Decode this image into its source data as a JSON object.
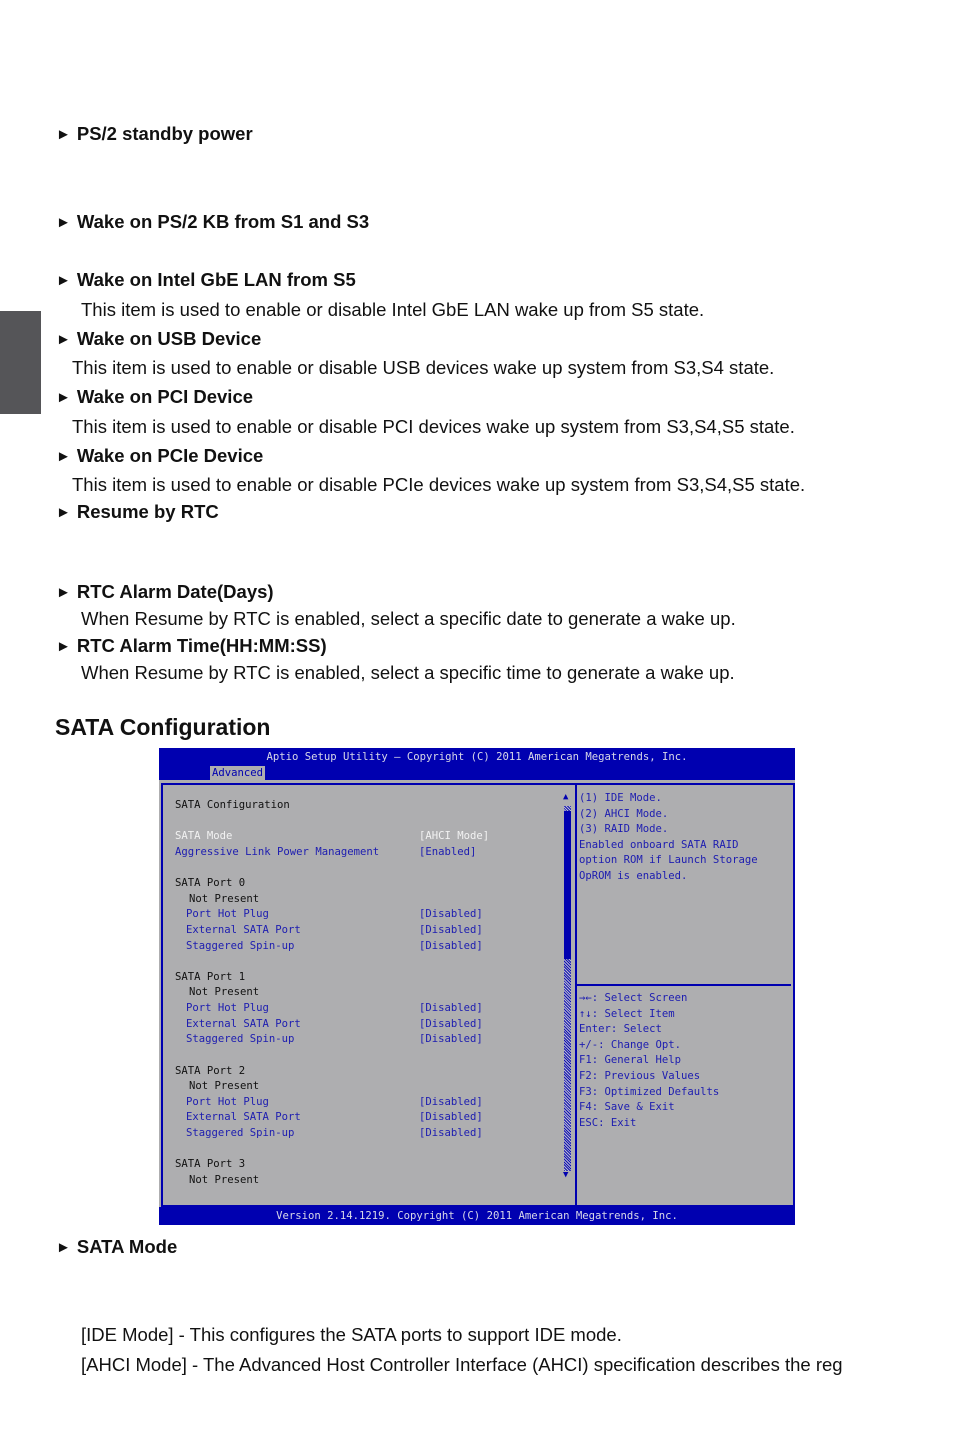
{
  "items": [
    {
      "title": "PS/2 standby power",
      "desc": ""
    },
    {
      "title": "Wake on PS/2 KB from S1 and S3",
      "desc": ""
    },
    {
      "title": "Wake on Intel GbE LAN from S5",
      "desc": "This item is used to enable or disable Intel GbE LAN wake up from S5 state."
    },
    {
      "title": "Wake on USB Device",
      "desc": "This item is used to enable or disable USB devices wake up system  from S3,S4 state."
    },
    {
      "title": "Wake on PCI Device",
      "desc": "This item is used to enable or disable PCI devices wake up system  from S3,S4,S5 state."
    },
    {
      "title": "Wake on PCIe Device",
      "desc": "This item is used to enable or disable PCIe devices wake up system  from S3,S4,S5 state."
    },
    {
      "title": "Resume by RTC",
      "desc": ""
    },
    {
      "title": "RTC Alarm Date(Days)",
      "desc": "When Resume by RTC is enabled, select a specific date to generate a wake up."
    },
    {
      "title": "RTC Alarm Time(HH:MM:SS)",
      "desc": "When Resume by RTC is enabled, select a specific time to generate a wake up."
    }
  ],
  "arrow": "►",
  "section_title": "SATA Configuration",
  "bios": {
    "title": "Aptio Setup Utility – Copyright (C) 2011 American Megatrends, Inc.",
    "tab": "Advanced",
    "footer": "Version 2.14.1219. Copyright (C) 2011 American Megatrends, Inc.",
    "rows": [
      {
        "label": "SATA Configuration",
        "value": "",
        "style": "black"
      },
      {
        "label": "SATA Mode",
        "value": "[AHCI Mode]",
        "style": "white"
      },
      {
        "label": "Aggressive Link Power Management",
        "value": "[Enabled]",
        "style": "blue"
      },
      {
        "label": "SATA Port 0",
        "value": "",
        "style": "black"
      },
      {
        "label": "Not Present",
        "value": "",
        "style": "black"
      },
      {
        "label": "Port Hot Plug",
        "value": "[Disabled]",
        "style": "blue"
      },
      {
        "label": "External SATA Port",
        "value": "[Disabled]",
        "style": "blue"
      },
      {
        "label": "Staggered Spin-up",
        "value": "[Disabled]",
        "style": "blue"
      },
      {
        "label": "SATA Port 1",
        "value": "",
        "style": "black"
      },
      {
        "label": "Not Present",
        "value": "",
        "style": "black"
      },
      {
        "label": "Port Hot Plug",
        "value": "[Disabled]",
        "style": "blue"
      },
      {
        "label": "External SATA Port",
        "value": "[Disabled]",
        "style": "blue"
      },
      {
        "label": "Staggered Spin-up",
        "value": "[Disabled]",
        "style": "blue"
      },
      {
        "label": "SATA Port 2",
        "value": "",
        "style": "black"
      },
      {
        "label": "Not Present",
        "value": "",
        "style": "black"
      },
      {
        "label": "Port Hot Plug",
        "value": "[Disabled]",
        "style": "blue"
      },
      {
        "label": "External SATA Port",
        "value": "[Disabled]",
        "style": "blue"
      },
      {
        "label": "Staggered Spin-up",
        "value": "[Disabled]",
        "style": "blue"
      },
      {
        "label": "SATA Port 3",
        "value": "",
        "style": "black"
      },
      {
        "label": "Not Present",
        "value": "",
        "style": "black"
      }
    ],
    "help": [
      "(1) IDE Mode.",
      "(2) AHCI Mode.",
      "(3) RAID Mode.",
      "Enabled onboard SATA RAID",
      "option ROM if Launch Storage",
      "OpROM is enabled."
    ],
    "keys": [
      "→←: Select Screen",
      "↑↓: Select Item",
      "Enter: Select",
      "+/-: Change Opt.",
      "F1: General Help",
      "F2: Previous Values",
      "F3: Optimized Defaults",
      "F4: Save & Exit",
      "ESC: Exit"
    ],
    "scroll_up": "▲",
    "scroll_down": "▼"
  },
  "after": {
    "title": "SATA Mode",
    "lines": [
      "[IDE Mode] - This configures the SATA ports to support IDE mode.",
      "[AHCI Mode] - The Advanced Host Controller Interface (AHCI) specification describes the reg"
    ]
  }
}
